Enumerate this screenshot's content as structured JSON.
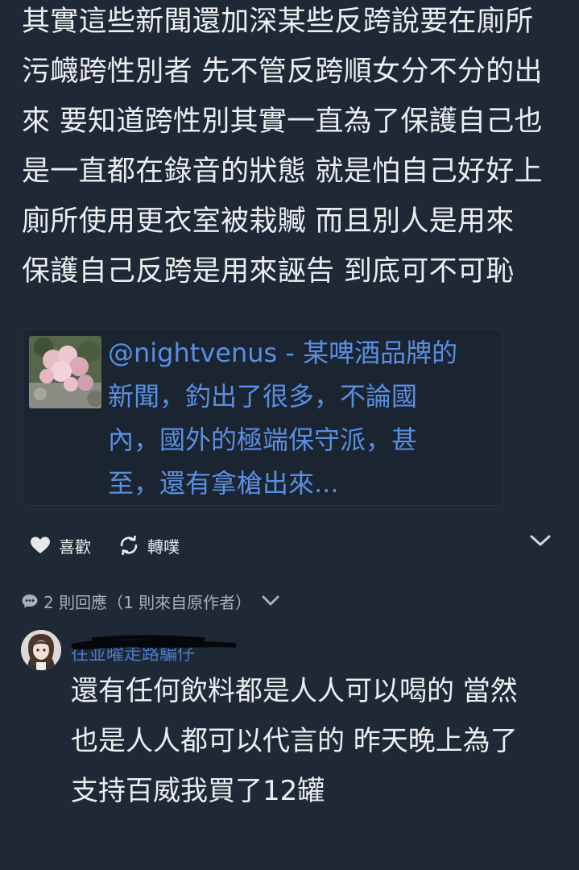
{
  "post": {
    "lines": [
      "其實這些新聞還加深某些反跨說要在廁所",
      "污衊跨性別者 先不管反跨順女分不分的出",
      "來 要知道跨性別其實一直為了保護自己也",
      "是一直都在錄音的狀態 就是怕自己好好上",
      "廁所使用更衣室被栽贓 而且別人是用來",
      "保護自己反跨是用來誣告 到底可不可恥"
    ]
  },
  "quote": {
    "lines": [
      "@nightvenus - 某啤酒品牌的",
      "新聞，釣出了很多，不論國",
      "內，國外的極端保守派，甚",
      "至，還有拿槍出來..."
    ],
    "thumbnail_icon": "flower-photo-thumbnail",
    "link_color": "#5a8ee0"
  },
  "actions": {
    "like_label": "喜歡",
    "reblog_label": "轉噗",
    "like_icon": "heart-icon",
    "reblog_icon": "repost-icon",
    "expand_icon": "chevron-down-icon"
  },
  "replies": {
    "summary": "2 則回應（1 則來自原作者）",
    "icon": "speech-bubble-icon"
  },
  "reply": {
    "author": "往並曜走路騙仔",
    "lines": [
      "還有任何飲料都是人人可以喝的 當然",
      "也是人人都可以代言的 昨天晚上為了",
      "支持百威我買了12罐"
    ]
  },
  "colors": {
    "background": "#1f2936",
    "text": "#ecedef",
    "author_link": "#4a79c8"
  }
}
